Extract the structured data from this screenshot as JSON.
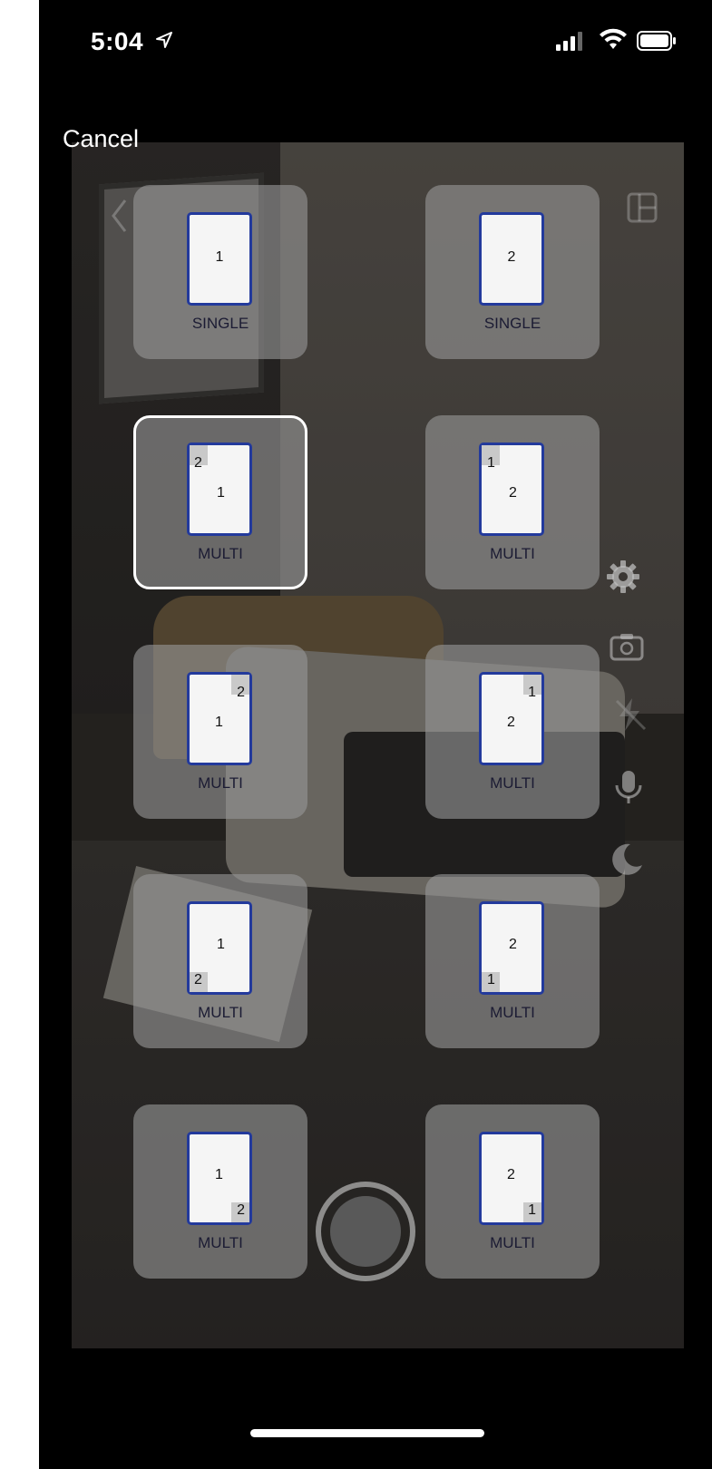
{
  "status_bar": {
    "time": "5:04"
  },
  "header": {
    "cancel_label": "Cancel"
  },
  "tiles": [
    {
      "id": "single-1",
      "label": "SINGLE",
      "big": "1",
      "small": ""
    },
    {
      "id": "single-2",
      "label": "SINGLE",
      "big": "2",
      "small": ""
    },
    {
      "id": "multi-2-1-tl",
      "label": "MULTI",
      "big": "1",
      "small": "2",
      "selected": true
    },
    {
      "id": "multi-1-2-tl",
      "label": "MULTI",
      "big": "2",
      "small": "1"
    },
    {
      "id": "multi-2-1-tr",
      "label": "MULTI",
      "big": "1",
      "small": "2"
    },
    {
      "id": "multi-1-2-tr",
      "label": "MULTI",
      "big": "2",
      "small": "1"
    },
    {
      "id": "multi-2-1-bl",
      "label": "MULTI",
      "big": "1",
      "small": "2"
    },
    {
      "id": "multi-1-2-bl",
      "label": "MULTI",
      "big": "2",
      "small": "1"
    },
    {
      "id": "multi-2-1-br",
      "label": "MULTI",
      "big": "1",
      "small": "2"
    },
    {
      "id": "multi-1-2-br",
      "label": "MULTI",
      "big": "2",
      "small": "1"
    }
  ],
  "icons": {
    "back": "chevron-left-icon",
    "layout": "layout-grid-icon",
    "settings": "gear-icon",
    "camera_flip": "camera-flip-icon",
    "flash": "flash-off-icon",
    "mic": "microphone-icon",
    "night": "moon-icon"
  },
  "colors": {
    "sheet_border": "#233a9c",
    "selected_border": "#ffffff"
  }
}
